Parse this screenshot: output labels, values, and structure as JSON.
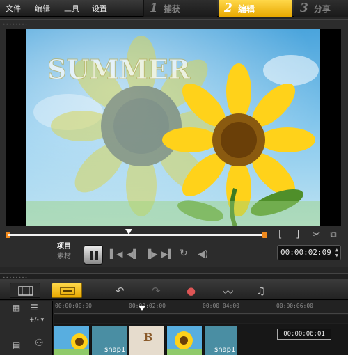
{
  "menu": [
    "文件",
    "编辑",
    "工具",
    "设置"
  ],
  "steps": [
    {
      "num": "1",
      "label": "捕获",
      "active": false
    },
    {
      "num": "2",
      "label": "编辑",
      "active": true
    },
    {
      "num": "3",
      "label": "分享",
      "active": false
    }
  ],
  "preview": {
    "overlay_text": "SUMMER"
  },
  "playback": {
    "mode_project": "项目",
    "mode_clip": "素材",
    "timecode": "00:00:02:09",
    "scrub_position": 0.47,
    "trim_in": "[",
    "trim_out": "]"
  },
  "timeline": {
    "ruler_labels": [
      "00:00:00:00",
      "00:00:02:00",
      "00:00:04:00",
      "00:00:06:00"
    ],
    "track_controls": "+/- ▾",
    "clips": [
      {
        "label": "",
        "type": "sunflower"
      },
      {
        "label": "snap1",
        "type": "plain"
      },
      {
        "label": "",
        "type": "title"
      },
      {
        "label": "",
        "type": "sunflower"
      },
      {
        "label": "snap1",
        "type": "plain"
      }
    ],
    "tooltip": "00:00:06:01"
  },
  "icons": {
    "undo": "undo-icon",
    "redo": "redo-icon",
    "record": "record-icon",
    "audio": "audio-mixer-icon",
    "auto_music": "auto-music-icon"
  },
  "colors": {
    "accent": "#f0b800",
    "scrub_end": "#f08a1e"
  }
}
